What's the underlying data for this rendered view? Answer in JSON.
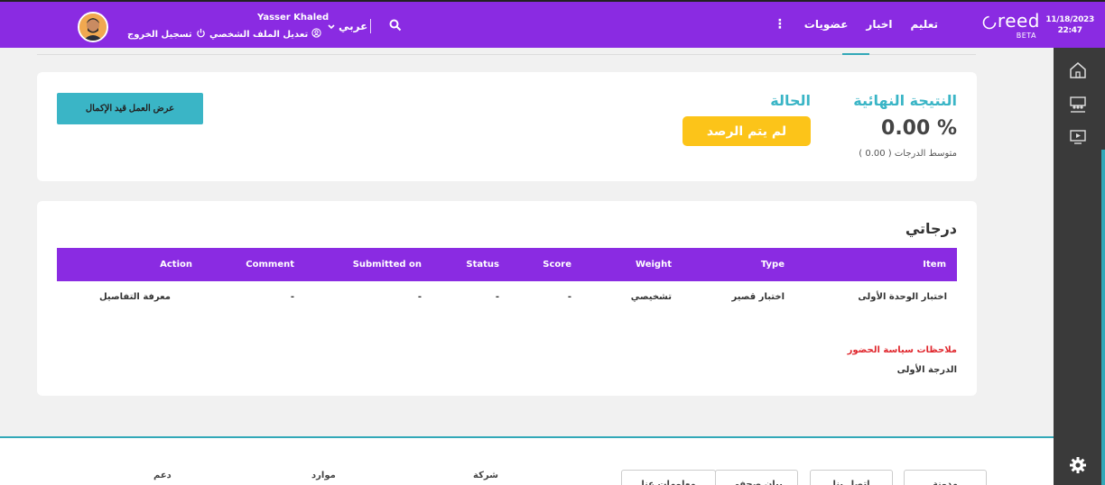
{
  "header": {
    "date": "11/18/2023",
    "time": "22:47",
    "logo_text": "reed",
    "logo_badge": "BETA",
    "nav": [
      "تعليم",
      "اخبار",
      "عضويات"
    ],
    "more_icon": "vertical-dots-icon",
    "search_icon": "search-icon",
    "language": "عربي",
    "username": "Yasser Khaled",
    "edit_profile": "تعديل الملف الشخصي",
    "logout": "تسجيل الخروج",
    "colors": {
      "bar": "#8a2be2"
    }
  },
  "sidebar": {
    "icons": [
      "home-icon",
      "classroom-icon",
      "video-icon",
      "settings-icon"
    ]
  },
  "result_card": {
    "final_result_label": "النتيجة النهائية",
    "final_result_value": "0.00 %",
    "average": "متوسط الدرجات ( 0.00 )",
    "status_label": "الحالة",
    "status_value": "لم يتم الرصد",
    "wip_button": "عرض العمل قيد الإكمال",
    "colors": {
      "accent": "#3ab5c6",
      "status": "#fcc419"
    }
  },
  "grades": {
    "title": "درجاتي",
    "columns": [
      "Item",
      "Type",
      "Weight",
      "Score",
      "Status",
      "Submitted on",
      "Comment",
      "Action"
    ],
    "rows": [
      [
        "اختبار الوحدة الأولى",
        "اختبار قصير",
        "تشخيصي",
        "-",
        "-",
        "-",
        "-",
        "معرفة التفاصيل"
      ]
    ],
    "remarks_title": "ملاحظات سياسة الحضور",
    "remarks_value": "الدرجة الأولى"
  },
  "footer": {
    "buttons": [
      "معلومات عنا",
      "اتصل بنا",
      "بيان صحفي",
      "مدونة"
    ],
    "columns": [
      "شركة",
      "موارد",
      "دعم"
    ]
  }
}
